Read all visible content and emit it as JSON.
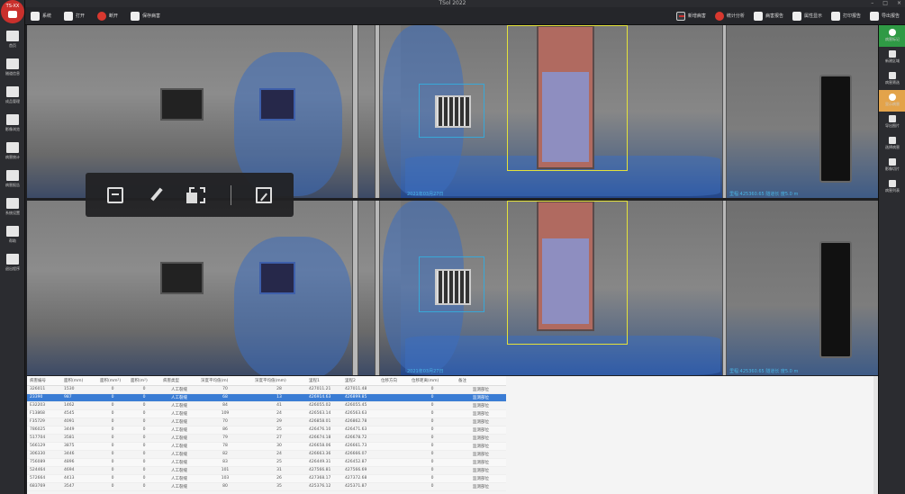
{
  "window": {
    "title": "TSol 2022"
  },
  "toolbar": {
    "left": [
      {
        "label": "系统",
        "icon": "home-icon"
      },
      {
        "label": "打开",
        "icon": "folder-icon"
      },
      {
        "label": "断开",
        "icon": "disconnect-icon"
      },
      {
        "label": "保存病害",
        "icon": "save-icon"
      }
    ],
    "right": [
      {
        "label": "新增病害",
        "icon": "pc-icon"
      },
      {
        "label": "统计分析",
        "icon": "pie-icon"
      },
      {
        "label": "病害报告",
        "icon": "report-icon"
      },
      {
        "label": "属性显示",
        "icon": "table-icon"
      },
      {
        "label": "打印报告",
        "icon": "print-icon"
      },
      {
        "label": "导出报告",
        "icon": "export-icon"
      }
    ]
  },
  "sidebar": {
    "logo": "TS-XX",
    "items": [
      {
        "label": "首页",
        "icon": "home-icon"
      },
      {
        "label": "隧道信息",
        "icon": "tunnel-icon"
      },
      {
        "label": "成品管理",
        "icon": "screen-icon"
      },
      {
        "label": "影像浏览",
        "icon": "image-icon"
      },
      {
        "label": "病害统计",
        "icon": "bar-chart-icon"
      },
      {
        "label": "病害报告",
        "icon": "report-icon"
      },
      {
        "label": "系统设置",
        "icon": "settings-icon"
      },
      {
        "label": "帮助",
        "icon": "help-icon"
      },
      {
        "label": "退出程序",
        "icon": "exit-icon"
      }
    ]
  },
  "rsidebar": {
    "items": [
      {
        "label": "病害标记",
        "icon": "add-icon",
        "style": "green"
      },
      {
        "label": "新建区域",
        "icon": "edit-icon",
        "style": ""
      },
      {
        "label": "病害筛选",
        "icon": "filter-icon",
        "style": ""
      },
      {
        "label": "显示病害",
        "icon": "layers-icon",
        "style": "orange"
      },
      {
        "label": "导出图片",
        "icon": "photo-icon",
        "style": ""
      },
      {
        "label": "选择病害",
        "icon": "select-icon",
        "style": ""
      },
      {
        "label": "影像切片",
        "icon": "slice-icon",
        "style": ""
      },
      {
        "label": "病害列表",
        "icon": "list-icon",
        "style": ""
      }
    ]
  },
  "image_panels": {
    "top": {
      "caption_left": "2021年03月27日",
      "caption_right": "里程:425360.65 隧道长 度5.0 m",
      "caption_far": "里程: 425360.65 ..."
    },
    "bottom": {
      "caption_left": "2021年03月27日",
      "caption_right": "里程:425360.65 隧道长 度5.0 m",
      "caption_far": "里程: 425360.65 ..."
    }
  },
  "float_toolbar": {
    "items": [
      "comment",
      "pen",
      "crop",
      "separator",
      "document"
    ]
  },
  "table": {
    "columns": [
      "病害编号",
      "面积(mm)",
      "面积(mm²)",
      "面积(m²)",
      "病害类型",
      "深度平均值(m)",
      "深度平均值(mm)",
      "里程1",
      "里程2",
      "位移方向",
      "位移距离(mm)",
      "备注"
    ],
    "rows": [
      [
        "326011",
        "1530",
        "0",
        "0",
        "人工裂缝",
        "70",
        "28",
        "427011.21",
        "427011.48",
        "",
        "0",
        "监测部位"
      ],
      [
        "23390",
        "987",
        "0",
        "0",
        "人工裂缝",
        "68",
        "13",
        "426914.63",
        "426899.85",
        "",
        "0",
        "监测部位"
      ],
      [
        "E32203",
        "1462",
        "0",
        "0",
        "人工裂缝",
        "84",
        "41",
        "426055.02",
        "426055.45",
        "",
        "0",
        "监测部位"
      ],
      [
        "F13868",
        "4545",
        "0",
        "0",
        "人工裂缝",
        "109",
        "24",
        "426563.14",
        "426563.63",
        "",
        "0",
        "监测部位"
      ],
      [
        "F35729",
        "4091",
        "0",
        "0",
        "人工裂缝",
        "70",
        "29",
        "426858.01",
        "426862.78",
        "",
        "0",
        "监测部位"
      ],
      [
        "786025",
        "3449",
        "0",
        "0",
        "人工裂缝",
        "86",
        "25",
        "426476.10",
        "426471.63",
        "",
        "0",
        "监测部位"
      ],
      [
        "517704",
        "3581",
        "0",
        "0",
        "人工裂缝",
        "79",
        "27",
        "426674.18",
        "426678.72",
        "",
        "0",
        "监测部位"
      ],
      [
        "566129",
        "3875",
        "0",
        "0",
        "人工裂缝",
        "78",
        "30",
        "426658.06",
        "426661.73",
        "",
        "0",
        "监测部位"
      ],
      [
        "306330",
        "3446",
        "0",
        "0",
        "人工裂缝",
        "82",
        "24",
        "426663.36",
        "426666.07",
        "",
        "0",
        "监测部位"
      ],
      [
        "756089",
        "4896",
        "0",
        "0",
        "人工裂缝",
        "83",
        "25",
        "426449.31",
        "426452.87",
        "",
        "0",
        "监测部位"
      ],
      [
        "524464",
        "4694",
        "0",
        "0",
        "人工裂缝",
        "101",
        "31",
        "427566.81",
        "427566.69",
        "",
        "0",
        "监测部位"
      ],
      [
        "572664",
        "4413",
        "0",
        "0",
        "人工裂缝",
        "103",
        "26",
        "427368.17",
        "427372.68",
        "",
        "0",
        "监测部位"
      ],
      [
        "683769",
        "3547",
        "0",
        "0",
        "人工裂缝",
        "80",
        "35",
        "425376.12",
        "425371.87",
        "",
        "0",
        "监测部位"
      ]
    ],
    "selected_index": 1
  },
  "colors": {
    "accent": "#3a7cd4",
    "green": "#2f9a45",
    "orange": "#e3a34a",
    "logo": "#c9302c"
  }
}
